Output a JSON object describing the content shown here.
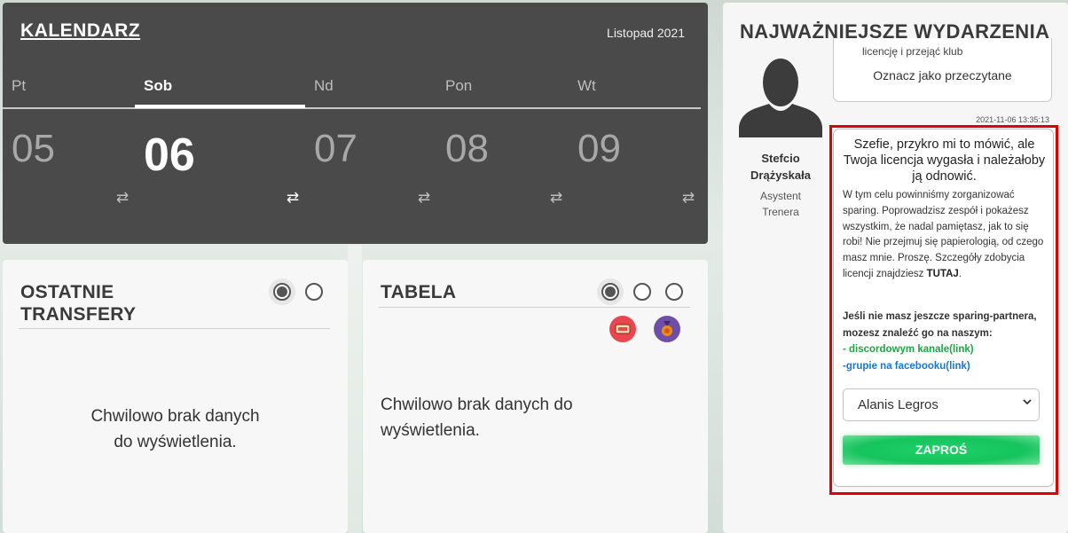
{
  "calendar": {
    "title": "KALENDARZ",
    "month": "Listopad 2021",
    "days": [
      {
        "name": "Pt",
        "number": "05"
      },
      {
        "name": "Sob",
        "number": "06",
        "active": true
      },
      {
        "name": "Nd",
        "number": "07"
      },
      {
        "name": "Pon",
        "number": "08"
      },
      {
        "name": "Wt",
        "number": "09"
      }
    ],
    "swap_icon": "⇄"
  },
  "transfers": {
    "title_line1": "OSTATNIE",
    "title_line2": "TRANSFERY",
    "empty_line1": "Chwilowo brak danych",
    "empty_line2": "do wyświetlenia."
  },
  "table": {
    "title": "TABELA",
    "empty_line1": "Chwilowo brak danych do",
    "empty_line2": "wyświetlenia."
  },
  "events": {
    "title": "NAJWAŻNIEJSZE WYDARZENIA",
    "sender": {
      "name_line1": "Stefcio",
      "name_line2": "Drążyskała",
      "role_line1": "Asystent",
      "role_line2": "Trenera"
    },
    "previous_message": {
      "snippet": "licencję i przejąć klub",
      "mark_read": "Oznacz jako przeczytane"
    },
    "timestamp": "2021-11-06 13:35:13",
    "message": {
      "headline": "Szefie, przykro mi to mówić, ale Twoja licencja wygasła i należałoby ją odnowić.",
      "body_text": "W tym celu powinniśmy zorganizować sparing. Poprowadzisz zespół i pokażesz wszystkim, że nadal pamiętasz, jak to się robi! Nie przejmuj się papierologią, od czego masz mnie. Proszę. Szczegóły zdobycia licencji znajdziesz",
      "body_link": "TUTAJ",
      "body_end": ".",
      "cta": "Jeśli nie masz jeszcze sparing-partnera, mozesz znaleźć go na naszym:",
      "discord_link": "- discordowym kanale(link)",
      "facebook_link": "-grupie na facebooku(link)",
      "select_value": "Alanis Legros",
      "invite_button": "ZAPROŚ"
    }
  }
}
